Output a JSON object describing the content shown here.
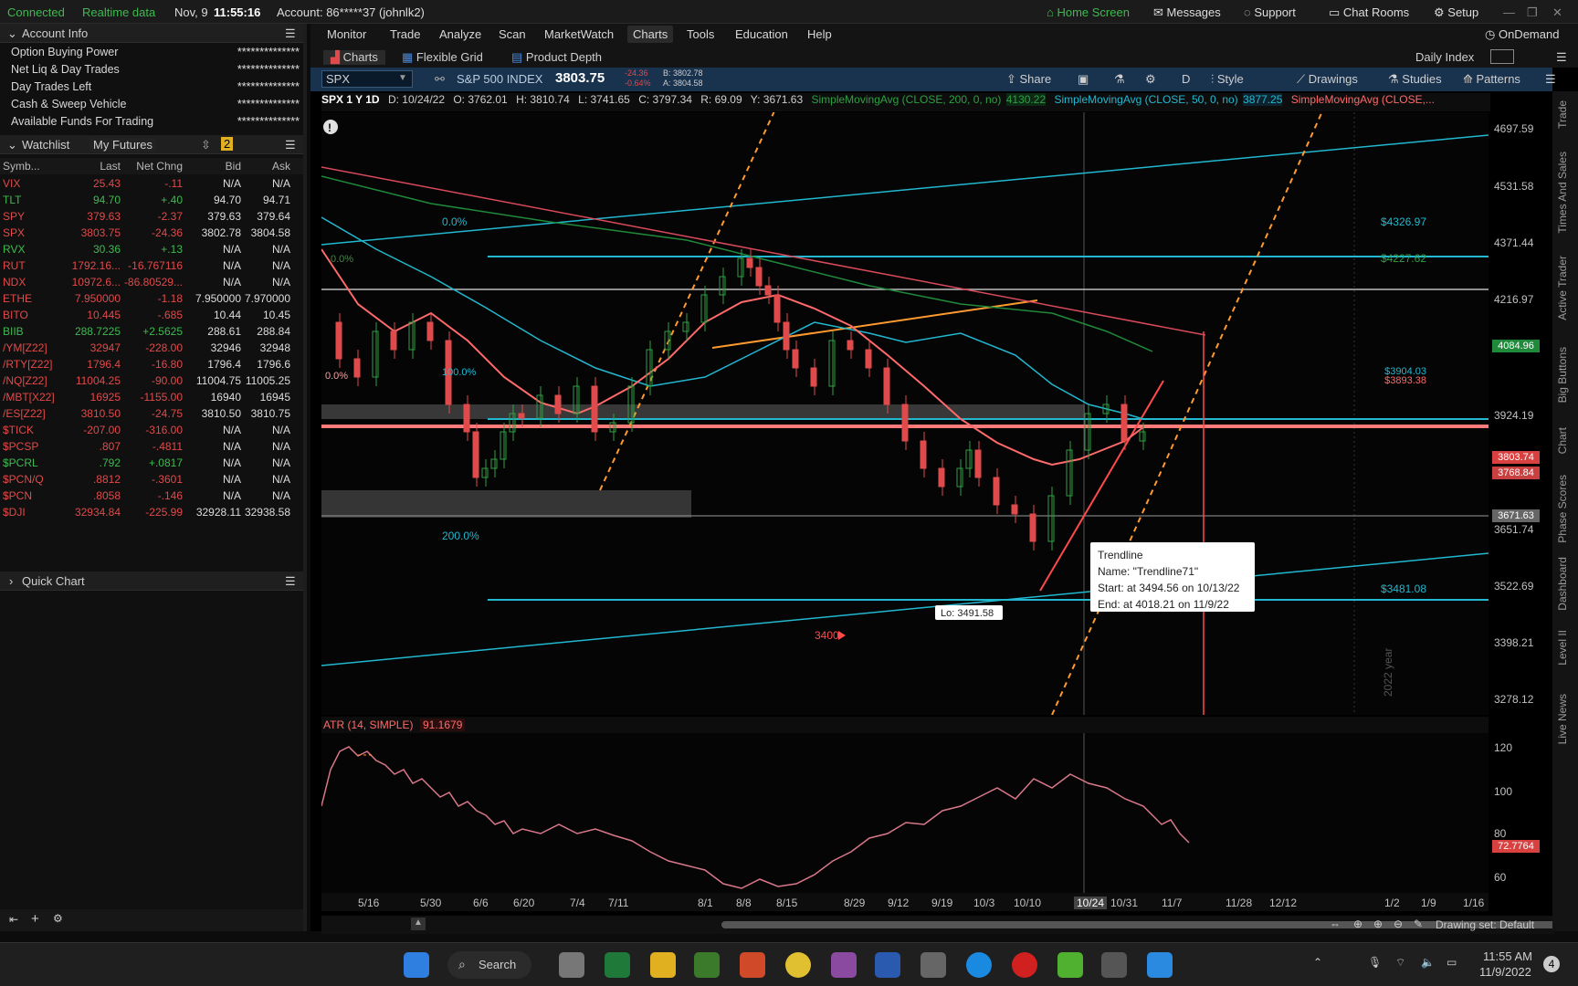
{
  "status": {
    "connected": "Connected",
    "realtime": "Realtime data",
    "date": "Nov, 9",
    "time": "11:55:16",
    "account": "Account: 86*****37 (johnlk2)",
    "home": "Home Screen",
    "messages": "Messages",
    "support": "Support",
    "chat": "Chat Rooms",
    "setup": "Setup"
  },
  "menu": [
    "Monitor",
    "Trade",
    "Analyze",
    "Scan",
    "MarketWatch",
    "Charts",
    "Tools",
    "Education",
    "Help"
  ],
  "menu_active": "Charts",
  "ondemand": "OnDemand",
  "subtabs": {
    "charts": "Charts",
    "flex": "Flexible Grid",
    "depth": "Product Depth",
    "daily": "Daily Index"
  },
  "account": {
    "title": "Account Info",
    "rows": [
      {
        "label": "Option Buying Power",
        "value": "**************"
      },
      {
        "label": "Net Liq & Day Trades",
        "value": "**************"
      },
      {
        "label": "Day Trades Left",
        "value": "**************"
      },
      {
        "label": "Cash & Sweep Vehicle",
        "value": "**************"
      },
      {
        "label": "Available Funds For Trading",
        "value": "**************"
      }
    ]
  },
  "watchlist": {
    "title": "Watchlist",
    "name": "My Futures",
    "badge": "2",
    "headers": [
      "Symb...",
      "Last",
      "Net Chng",
      "Bid",
      "Ask"
    ],
    "rows": [
      {
        "s": "VIX",
        "last": "25.43",
        "chg": "-.11",
        "bid": "N/A",
        "ask": "N/A",
        "c": "#e04a4a"
      },
      {
        "s": "TLT",
        "last": "94.70",
        "chg": "+.40",
        "bid": "94.70",
        "ask": "94.71",
        "c": "#3fb950"
      },
      {
        "s": "SPY",
        "last": "379.63",
        "chg": "-2.37",
        "bid": "379.63",
        "ask": "379.64",
        "c": "#e04a4a"
      },
      {
        "s": "SPX",
        "last": "3803.75",
        "chg": "-24.36",
        "bid": "3802.78",
        "ask": "3804.58",
        "c": "#e04a4a"
      },
      {
        "s": "RVX",
        "last": "30.36",
        "chg": "+.13",
        "bid": "N/A",
        "ask": "N/A",
        "c": "#3fb950"
      },
      {
        "s": "RUT",
        "last": "1792.16...",
        "chg": "-16.767116",
        "bid": "N/A",
        "ask": "N/A",
        "c": "#e04a4a"
      },
      {
        "s": "NDX",
        "last": "10972.6...",
        "chg": "-86.80529...",
        "bid": "N/A",
        "ask": "N/A",
        "c": "#e04a4a"
      },
      {
        "s": "ETHE",
        "last": "7.950000",
        "chg": "-1.18",
        "bid": "7.950000",
        "ask": "7.970000",
        "c": "#e04a4a"
      },
      {
        "s": "BITO",
        "last": "10.445",
        "chg": "-.685",
        "bid": "10.44",
        "ask": "10.45",
        "c": "#e04a4a"
      },
      {
        "s": "BIIB",
        "last": "288.7225",
        "chg": "+2.5625",
        "bid": "288.61",
        "ask": "288.84",
        "c": "#3fb950"
      },
      {
        "s": "/YM[Z22]",
        "last": "32947",
        "chg": "-228.00",
        "bid": "32946",
        "ask": "32948",
        "c": "#e04a4a"
      },
      {
        "s": "/RTY[Z22]",
        "last": "1796.4",
        "chg": "-16.80",
        "bid": "1796.4",
        "ask": "1796.6",
        "c": "#e04a4a"
      },
      {
        "s": "/NQ[Z22]",
        "last": "11004.25",
        "chg": "-90.00",
        "bid": "11004.75",
        "ask": "11005.25",
        "c": "#e04a4a"
      },
      {
        "s": "/MBT[X22]",
        "last": "16925",
        "chg": "-1155.00",
        "bid": "16940",
        "ask": "16945",
        "c": "#e04a4a"
      },
      {
        "s": "/ES[Z22]",
        "last": "3810.50",
        "chg": "-24.75",
        "bid": "3810.50",
        "ask": "3810.75",
        "c": "#e04a4a"
      },
      {
        "s": "$TICK",
        "last": "-207.00",
        "chg": "-316.00",
        "bid": "N/A",
        "ask": "N/A",
        "c": "#e04a4a"
      },
      {
        "s": "$PCSP",
        "last": ".807",
        "chg": "-.4811",
        "bid": "N/A",
        "ask": "N/A",
        "c": "#e04a4a"
      },
      {
        "s": "$PCRL",
        "last": ".792",
        "chg": "+.0817",
        "bid": "N/A",
        "ask": "N/A",
        "c": "#3fb950"
      },
      {
        "s": "$PCN/Q",
        "last": ".8812",
        "chg": "-.3601",
        "bid": "N/A",
        "ask": "N/A",
        "c": "#e04a4a"
      },
      {
        "s": "$PCN",
        "last": ".8058",
        "chg": "-.146",
        "bid": "N/A",
        "ask": "N/A",
        "c": "#e04a4a"
      },
      {
        "s": "$DJI",
        "last": "32934.84",
        "chg": "-225.99",
        "bid": "32928.11",
        "ask": "32938.58",
        "c": "#e04a4a"
      }
    ]
  },
  "quickchart": "Quick Chart",
  "symbol": {
    "ticker": "SPX",
    "name": "S&P 500 INDEX",
    "price": "3803.75",
    "chg": "-24.36",
    "pct": "-0.64%",
    "bid": "B: 3802.78",
    "ask": "A: 3804.58",
    "share": "Share",
    "style": "Style",
    "drawings": "Drawings",
    "studies": "Studies",
    "patterns": "Patterns",
    "period": "D"
  },
  "info": {
    "title": "SPX 1 Y 1D",
    "d": "D: 10/24/22",
    "o": "O: 3762.01",
    "h": "H: 3810.74",
    "l": "L: 3741.65",
    "c": "C: 3797.34",
    "r": "R: 69.09",
    "y": "Y: 3671.63",
    "sma200": "SimpleMovingAvg (CLOSE, 200, 0, no)",
    "sma200v": "4130.22",
    "sma50": "SimpleMovingAvg (CLOSE, 50, 0, no)",
    "sma50v": "3877.25",
    "sma3": "SimpleMovingAvg (CLOSE,..."
  },
  "yaxis": [
    "4697.59",
    "4531.58",
    "4371.44",
    "4216.97",
    "3924.19",
    "3651.74",
    "3522.69",
    "3398.21",
    "3278.12"
  ],
  "price_labels": {
    "p1": "$4326.97",
    "p2": "$4227.62",
    "p3": "$3904.03",
    "p4": "$3893.38",
    "p5": "$3481.08",
    "box1": "4084.96",
    "box2": "3803.74",
    "box3": "3768.84",
    "box4": "3671.63"
  },
  "fib": {
    "f0": "0.0%",
    "f100": "100.0%",
    "f200": "200.0%",
    "f00b": "0.0%",
    "f00c": "0.0%"
  },
  "annot": {
    "lo": "Lo: 3491.58",
    "n3400": "3400",
    "year": "2022 year"
  },
  "tooltip": {
    "l1": "Trendline",
    "l2": "Name: \"Trendline71\"",
    "l3": "Start: at 3494.56 on 10/13/22",
    "l4": "End: at 4018.21 on 11/9/22"
  },
  "atr": {
    "label": "ATR (14, SIMPLE)",
    "value": "91.1679",
    "last": "72.7764",
    "axis": [
      "120",
      "100",
      "80",
      "60"
    ]
  },
  "dates": [
    "5/16",
    "5/30",
    "6/6",
    "6/20",
    "7/4",
    "7/11",
    "8/1",
    "8/8",
    "8/15",
    "8/29",
    "9/12",
    "9/19",
    "10/3",
    "10/10",
    "10/24",
    "10/31",
    "11/7",
    "11/28",
    "12/12",
    "1/2",
    "1/9",
    "1/16"
  ],
  "drawing_set": "Drawing set: Default",
  "sidebar": [
    "Trade",
    "Times And Sales",
    "Active Trader",
    "Big Buttons",
    "Chart",
    "Phase Scores",
    "Dashboard",
    "Level II",
    "Live News"
  ],
  "taskbar": {
    "search": "Search",
    "time": "11:55 AM",
    "date": "11/9/2022",
    "notif": "4"
  }
}
